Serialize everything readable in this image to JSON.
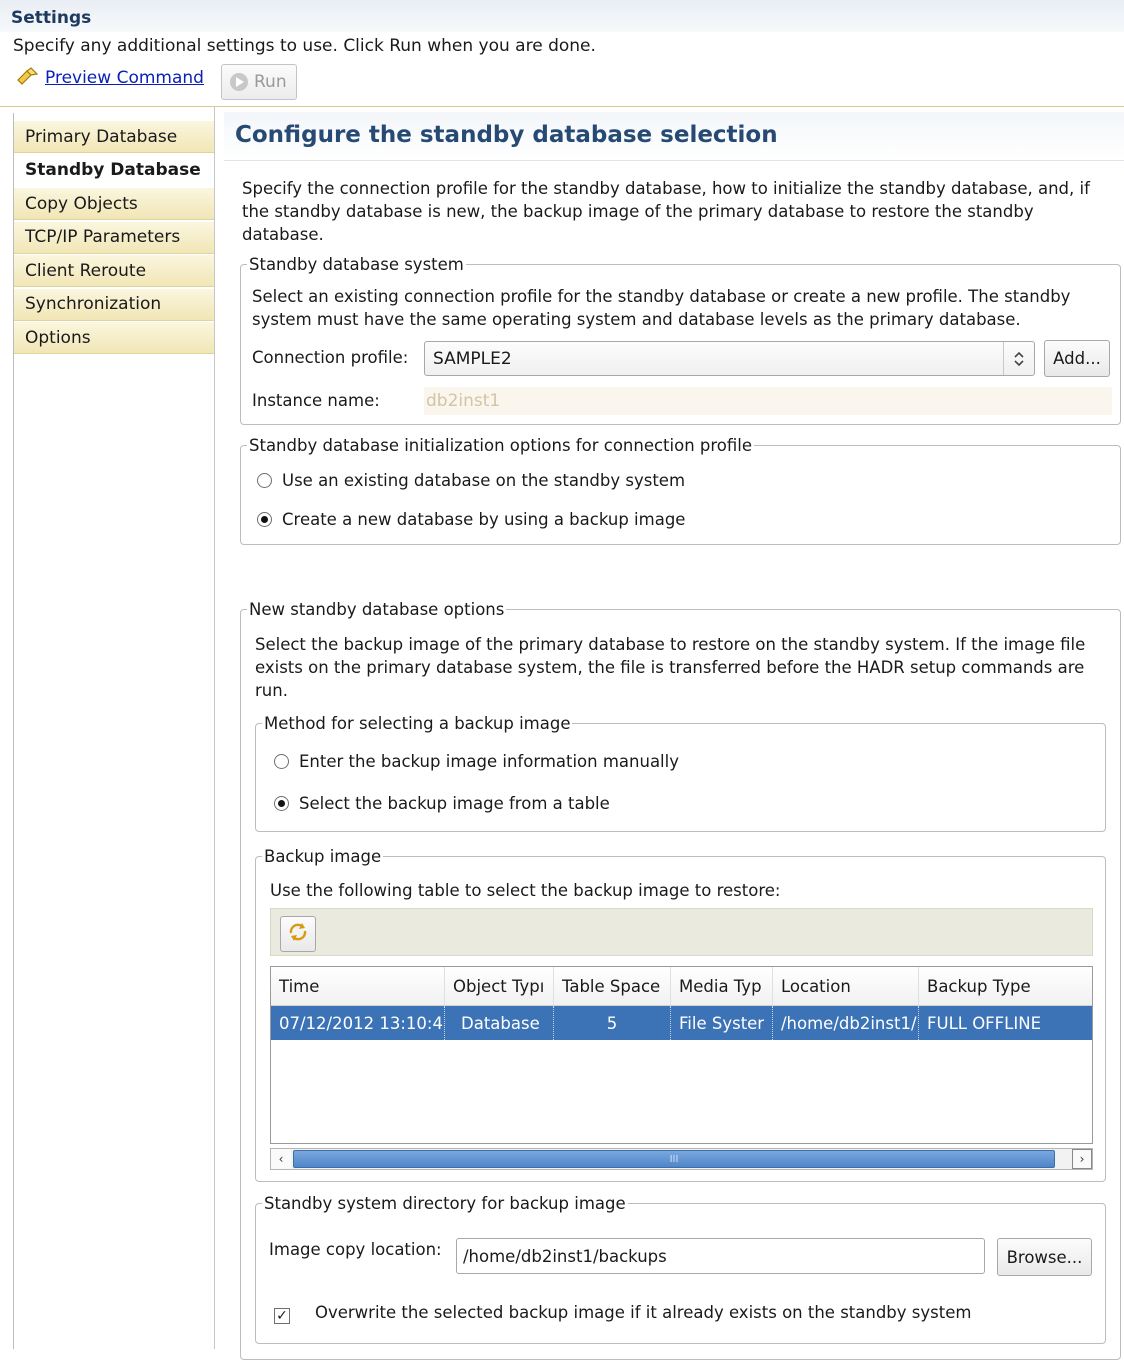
{
  "header": {
    "title": "Settings",
    "description": "Specify any additional settings to use. Click Run when you are done.",
    "preview_label": "Preview Command",
    "run_label": "Run"
  },
  "nav": {
    "items": [
      {
        "label": "Primary Database"
      },
      {
        "label": "Standby Database"
      },
      {
        "label": "Copy Objects"
      },
      {
        "label": "TCP/IP Parameters"
      },
      {
        "label": "Client Reroute"
      },
      {
        "label": "Synchronization"
      },
      {
        "label": "Options"
      }
    ],
    "active": "Standby Database"
  },
  "main": {
    "title": "Configure the standby database selection",
    "intro_line1": "Specify the connection profile for the standby database, how to initialize the standby database, and, if",
    "intro_line2": "the standby database is new, the backup image of the primary database to restore the standby",
    "intro_line3": "database."
  },
  "standby_system": {
    "legend": "Standby database system",
    "desc_line1": "Select an existing connection profile for the standby database or create a new profile. The standby",
    "desc_line2": "system must have the same operating system and database levels as the primary database.",
    "profile_label": "Connection profile:",
    "profile_value": "SAMPLE2",
    "add_label": "Add...",
    "instance_label": "Instance name:",
    "instance_value": "db2inst1"
  },
  "init_options": {
    "legend": "Standby database initialization options for connection profile",
    "option1": "Use an existing database on the standby system",
    "option2": "Create a new database by using a backup image",
    "selected": "option2"
  },
  "new_db": {
    "legend": "New standby database options",
    "desc_line1": "Select the backup image of the primary database to restore on the standby system. If the image file",
    "desc_line2": "exists on the primary database system, the file is transferred before the HADR setup commands are",
    "desc_line3": "run."
  },
  "method": {
    "legend": "Method for selecting a backup image",
    "option1": "Enter the backup image information manually",
    "option2": "Select the backup image from a table",
    "selected": "option2"
  },
  "backup_image": {
    "legend": "Backup image",
    "desc": "Use the following table to select the backup image to restore:",
    "columns": [
      "Time",
      "Object Typı",
      "Table Space",
      "Media Typ",
      "Location",
      "Backup Type"
    ],
    "rows": [
      [
        "07/12/2012 13:10:4",
        "Database",
        "5",
        "File Syster",
        "/home/db2inst1/",
        "FULL OFFLINE"
      ]
    ],
    "scroll_grip": "III"
  },
  "directory": {
    "legend": "Standby system directory for backup image",
    "label": "Image copy location:",
    "value": "/home/db2inst1/backups",
    "browse_label": "Browse...",
    "overwrite_label": "Overwrite the selected backup image if it already exists on the standby system",
    "overwrite_checked": true
  }
}
